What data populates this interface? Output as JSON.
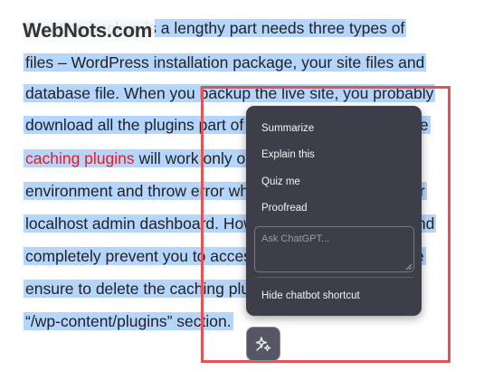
{
  "article": {
    "line1": "Creating backup is a lengthy part needs three types of",
    "line2": "files – WordPress installation package, your site files and",
    "line3": "database file. When you backup the live site, you probably",
    "line4": "download all the plugins part of the package. Some of the",
    "line5_link": "caching plugins",
    "line5_rest": " will work only on the server",
    "line6": "environment and throw error when you try to access your",
    "line7": "localhost admin dashboard. However, this will not fully and",
    "line8": "completely prevent you to access the admin panel. Make",
    "line9": "ensure to delete the caching plugins from the local",
    "line10": "“/wp-content/plugins” section."
  },
  "logo": {
    "text": "WebNots.com"
  },
  "colors": {
    "selection": "#b4d5fe",
    "link": "#e02020",
    "highlight_box": "#e25353",
    "menu_bg": "#3e3e4a"
  },
  "menu": {
    "items": [
      {
        "label": "Summarize"
      },
      {
        "label": "Explain this"
      },
      {
        "label": "Quiz me"
      },
      {
        "label": "Proofread"
      }
    ],
    "ask_placeholder": "Ask ChatGPT...",
    "hide_label": "Hide chatbot shortcut"
  },
  "fab": {
    "icon": "sparkle-icon"
  }
}
